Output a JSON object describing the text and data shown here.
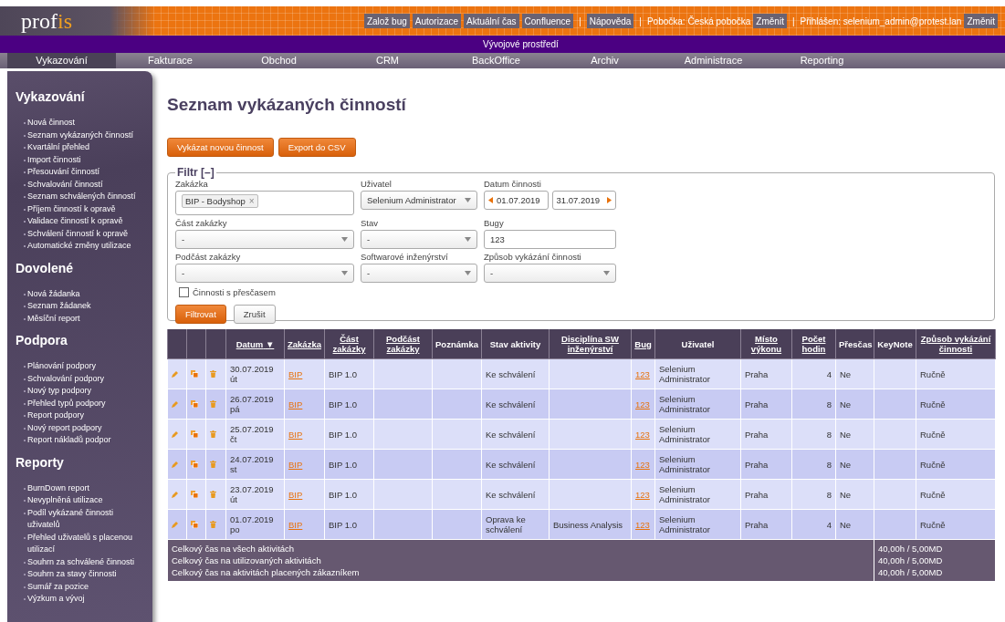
{
  "header": {
    "logo_parts": [
      "prof",
      "is"
    ],
    "items": [
      {
        "kind": "button",
        "label": "Založ bug"
      },
      {
        "kind": "button",
        "label": "Autorizace"
      },
      {
        "kind": "button",
        "label": "Aktuální čas"
      },
      {
        "kind": "button",
        "label": "Confluence"
      },
      {
        "kind": "separator",
        "label": "|"
      },
      {
        "kind": "button",
        "label": "Nápověda"
      },
      {
        "kind": "separator",
        "label": "|"
      },
      {
        "kind": "text",
        "label": "Pobočka: Česká pobočka"
      },
      {
        "kind": "button",
        "label": "Změnit"
      },
      {
        "kind": "separator",
        "label": "|"
      },
      {
        "kind": "text",
        "label": "Přihlášen: selenium_admin@protest.lan"
      },
      {
        "kind": "button",
        "label": "Změnit"
      }
    ]
  },
  "environment_banner": "Vývojové prostředí",
  "tabs": [
    {
      "label": "Vykazování",
      "selected": true
    },
    {
      "label": "Fakturace",
      "selected": false
    },
    {
      "label": "Obchod",
      "selected": false
    },
    {
      "label": "CRM",
      "selected": false
    },
    {
      "label": "BackOffice",
      "selected": false
    },
    {
      "label": "Archiv",
      "selected": false
    },
    {
      "label": "Administrace",
      "selected": false
    },
    {
      "label": "Reporting",
      "selected": false
    }
  ],
  "sidebar": {
    "sections": [
      {
        "heading": "Vykazování",
        "items": [
          "Nová činnost",
          "Seznam vykázaných činností",
          "Kvartální přehled",
          "Import činnosti",
          "Přesouvání činností",
          "Schvalování činností",
          "Seznam schválených činností",
          "Příjem činností k opravě",
          "Validace činností k opravě",
          "Schválení činností k opravě",
          "Automatické změny utilizace"
        ]
      },
      {
        "heading": "Dovolené",
        "items": [
          "Nová žádanka",
          "Seznam žádanek",
          "Měsíční report"
        ]
      },
      {
        "heading": "Podpora",
        "items": [
          "Plánování podpory",
          "Schvalování podpory",
          "Nový typ podpory",
          "Přehled typů podpory",
          "Report podpory",
          "Nový report podpory",
          "Report nákladů podpor"
        ]
      },
      {
        "heading": "Reporty",
        "items": [
          "BurnDown report",
          "Nevyplněná utilizace",
          "Podíl vykázané činnosti uživatelů",
          "Přehled uživatelů s placenou utilizací",
          "Souhrn za schválené činnosti",
          "Souhrn za stavy činnosti",
          "Sumář za pozice",
          "Výzkum a vývoj"
        ]
      }
    ]
  },
  "page_title": "Seznam vykázaných činností",
  "actions": [
    "Vykázat novou činnost",
    "Export do CSV"
  ],
  "filter": {
    "legend": "Filtr [–]",
    "fields": [
      {
        "kind": "token",
        "label": "Zakázka",
        "token": "BIP - Bodyshop",
        "remove": "×"
      },
      {
        "kind": "select",
        "label": "Uživatel",
        "value": "Selenium Administrator"
      },
      {
        "kind": "daterange",
        "label": "Datum činnosti",
        "from": "01.07.2019",
        "to": "31.07.2019"
      },
      {
        "kind": "select",
        "label": "Část zakázky",
        "value": "-"
      },
      {
        "kind": "select",
        "label": "Stav",
        "value": "-"
      },
      {
        "kind": "text",
        "label": "Bugy",
        "value": "123"
      },
      {
        "kind": "select",
        "label": "Podčást zakázky",
        "value": "-"
      },
      {
        "kind": "select",
        "label": "Softwarové inženýrství",
        "value": "-"
      },
      {
        "kind": "select",
        "label": "Způsob vykázání činnosti",
        "value": "-"
      }
    ],
    "checkbox": {
      "label": "Činnosti s přesčasem",
      "checked": false
    },
    "buttons": [
      {
        "label": "Filtrovat",
        "kind": "primary"
      },
      {
        "label": "Zrušit",
        "kind": "secondary"
      }
    ]
  },
  "table": {
    "columns": [
      {
        "label": "Datum",
        "sortable": true,
        "sort_indicator": "▼"
      },
      {
        "label": "Zakázka",
        "sortable": true
      },
      {
        "label": "Část zakázky",
        "sortable": true
      },
      {
        "label": "Podčást zakázky",
        "sortable": true
      },
      {
        "label": "Poznámka",
        "sortable": false
      },
      {
        "label": "Stav aktivity",
        "sortable": false
      },
      {
        "label": "Disciplína SW inženýrství",
        "sortable": true
      },
      {
        "label": "Bug",
        "sortable": true
      },
      {
        "label": "Uživatel",
        "sortable": false
      },
      {
        "label": "Místo výkonu",
        "sortable": true
      },
      {
        "label": "Počet hodin",
        "sortable": true
      },
      {
        "label": "Přesčas",
        "sortable": false
      },
      {
        "label": "KeyNote",
        "sortable": false
      },
      {
        "label": "Způsob vykázání činnosti",
        "sortable": true
      }
    ],
    "rows": [
      {
        "date": "30.07.2019",
        "day": "út",
        "project": "BIP",
        "project_part": "BIP 1.0",
        "status": "Ke schválení",
        "bug": "123",
        "user": "Selenium Administrator",
        "place": "Praha",
        "hours": "4",
        "overtime": "Ne",
        "method": "Ručně"
      },
      {
        "date": "26.07.2019",
        "day": "pá",
        "project": "BIP",
        "project_part": "BIP 1.0",
        "status": "Ke schválení",
        "bug": "123",
        "user": "Selenium Administrator",
        "place": "Praha",
        "hours": "8",
        "overtime": "Ne",
        "method": "Ručně"
      },
      {
        "date": "25.07.2019",
        "day": "čt",
        "project": "BIP",
        "project_part": "BIP 1.0",
        "status": "Ke schválení",
        "bug": "123",
        "user": "Selenium Administrator",
        "place": "Praha",
        "hours": "8",
        "overtime": "Ne",
        "method": "Ručně"
      },
      {
        "date": "24.07.2019",
        "day": "st",
        "project": "BIP",
        "project_part": "BIP 1.0",
        "status": "Ke schválení",
        "bug": "123",
        "user": "Selenium Administrator",
        "place": "Praha",
        "hours": "8",
        "overtime": "Ne",
        "method": "Ručně"
      },
      {
        "date": "23.07.2019",
        "day": "út",
        "project": "BIP",
        "project_part": "BIP 1.0",
        "status": "Ke schválení",
        "bug": "123",
        "user": "Selenium Administrator",
        "place": "Praha",
        "hours": "8",
        "overtime": "Ne",
        "method": "Ručně"
      },
      {
        "date": "01.07.2019",
        "day": "po",
        "project": "BIP",
        "project_part": "BIP 1.0",
        "status": "Oprava ke schválení",
        "discipline": "Business Analysis",
        "bug": "123",
        "user": "Selenium Administrator",
        "place": "Praha",
        "hours": "4",
        "overtime": "Ne",
        "method": "Ručně"
      }
    ],
    "summary": [
      {
        "label": "Celkový čas na všech aktivitách",
        "value": "40,00h / 5,00MD"
      },
      {
        "label": "Celkový čas na utilizovaných aktivitách",
        "value": "40,00h / 5,00MD"
      },
      {
        "label": "Celkový čas na aktivitách placených zákazníkem",
        "value": "40,00h / 5,00MD"
      }
    ]
  }
}
